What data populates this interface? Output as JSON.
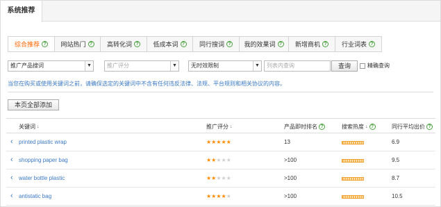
{
  "title_tab": "系统推荐",
  "tabs": [
    {
      "label": "综合推荐",
      "active": true
    },
    {
      "label": "网站热门",
      "active": false
    },
    {
      "label": "高转化词",
      "active": false
    },
    {
      "label": "低成本词",
      "active": false
    },
    {
      "label": "同行搜词",
      "active": false
    },
    {
      "label": "我的效果词",
      "active": false
    },
    {
      "label": "新增商机",
      "active": false
    },
    {
      "label": "行业词表",
      "active": false
    }
  ],
  "filters": {
    "product_select": "推广产品搜词",
    "score_select": "推广评分",
    "time_select": "无时效限制",
    "search_placeholder": "列表内查询",
    "search_button": "查询",
    "exact_label": "精确查询"
  },
  "notice": "当您在购买或使用关键词之前，请确保选定的关键词中不含有任何违反法律、法规、平台规则和相关协议的内容。",
  "add_all_button": "本页全部添加",
  "table": {
    "headers": {
      "keyword": "关键词",
      "score": "推广评分",
      "rank": "产品即时排名",
      "heat": "搜索热度",
      "bid": "同行平均出价"
    },
    "rows": [
      {
        "keyword": "printed plastic wrap",
        "stars": 5,
        "rank": "13",
        "bid": "6.9"
      },
      {
        "keyword": "shopping paper bag",
        "stars": 2,
        "rank": ">100",
        "bid": "9.5"
      },
      {
        "keyword": "water bottle plastic",
        "stars": 2,
        "rank": ">100",
        "bid": "8.7"
      },
      {
        "keyword": "antistatic bag",
        "stars": 4,
        "rank": ">100",
        "bid": "10.5"
      }
    ]
  },
  "colors": {
    "active_tab": "#ff6600",
    "link": "#3b79c5",
    "star": "#ff8a00",
    "help_icon": "#48a23c"
  }
}
